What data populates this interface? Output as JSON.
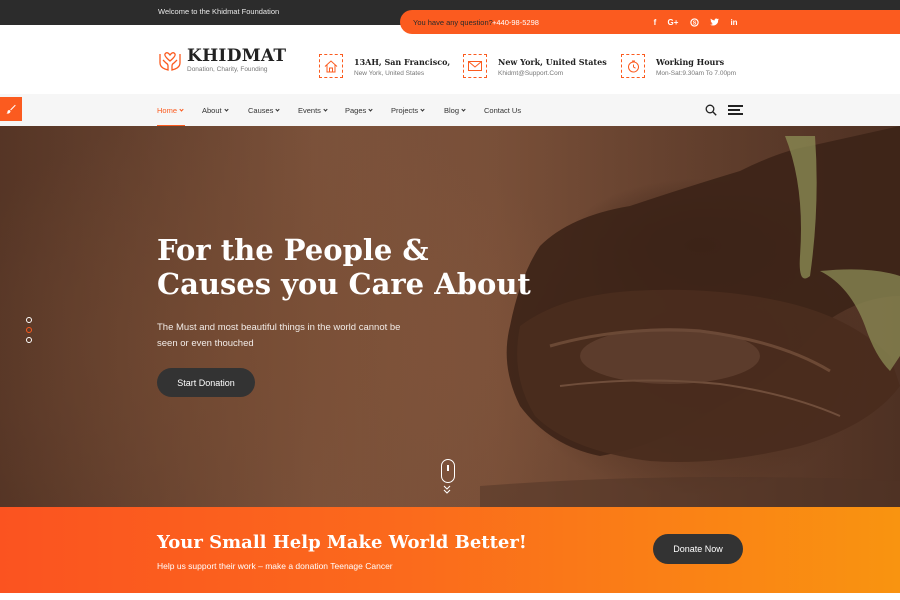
{
  "topbar": {
    "welcome": "Welcome to the Khidmat Foundation",
    "question_label": "You have any question?",
    "phone": "+440-98-5298",
    "social_icons": [
      "facebook-icon",
      "google-plus-icon",
      "skype-icon",
      "twitter-icon",
      "linkedin-icon"
    ]
  },
  "brand": {
    "name": "KHIDMAT",
    "tagline": "Donation, Charity, Founding"
  },
  "info": [
    {
      "icon": "home-icon",
      "title": "13AH, San Francisco,",
      "sub": "New York, United States"
    },
    {
      "icon": "mail-icon",
      "title": "New York, United States",
      "sub": "Khidmt@Support.Com"
    },
    {
      "icon": "clock-icon",
      "title": "Working Hours",
      "sub": "Mon-Sat:9.30am To 7.00pm"
    }
  ],
  "nav": {
    "items": [
      "Home",
      "About",
      "Causes",
      "Events",
      "Pages",
      "Projects",
      "Blog",
      "Contact Us"
    ],
    "active": "Home"
  },
  "hero": {
    "title_line1": "For the People &",
    "title_line2": "Causes you Care About",
    "text": "The Must and most beautiful things in the world cannot be seen or even thouched",
    "button": "Start Donation"
  },
  "cta": {
    "title": "Your Small Help Make World Better!",
    "subtitle": "Help us support their work – make a donation Teenage Cancer",
    "button": "Donate Now"
  },
  "colors": {
    "accent": "#fb5b1f",
    "dark": "#2c2c2c",
    "cta_end": "#f99410"
  }
}
